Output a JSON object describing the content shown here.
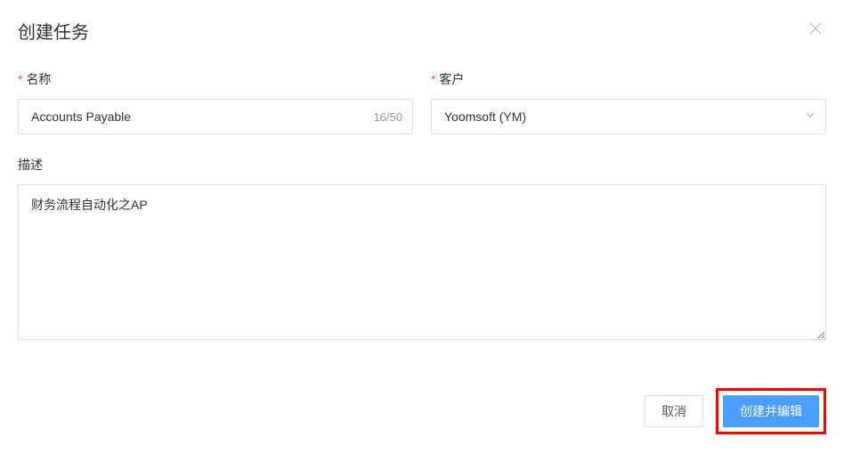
{
  "dialog": {
    "title": "创建任务"
  },
  "form": {
    "name": {
      "label": "名称",
      "value": "Accounts Payable",
      "counter": "16/50"
    },
    "customer": {
      "label": "客户",
      "value": "Yoomsoft (YM)"
    },
    "description": {
      "label": "描述",
      "value": "财务流程自动化之AP"
    }
  },
  "footer": {
    "cancel": "取消",
    "createAndEdit": "创建并编辑"
  }
}
